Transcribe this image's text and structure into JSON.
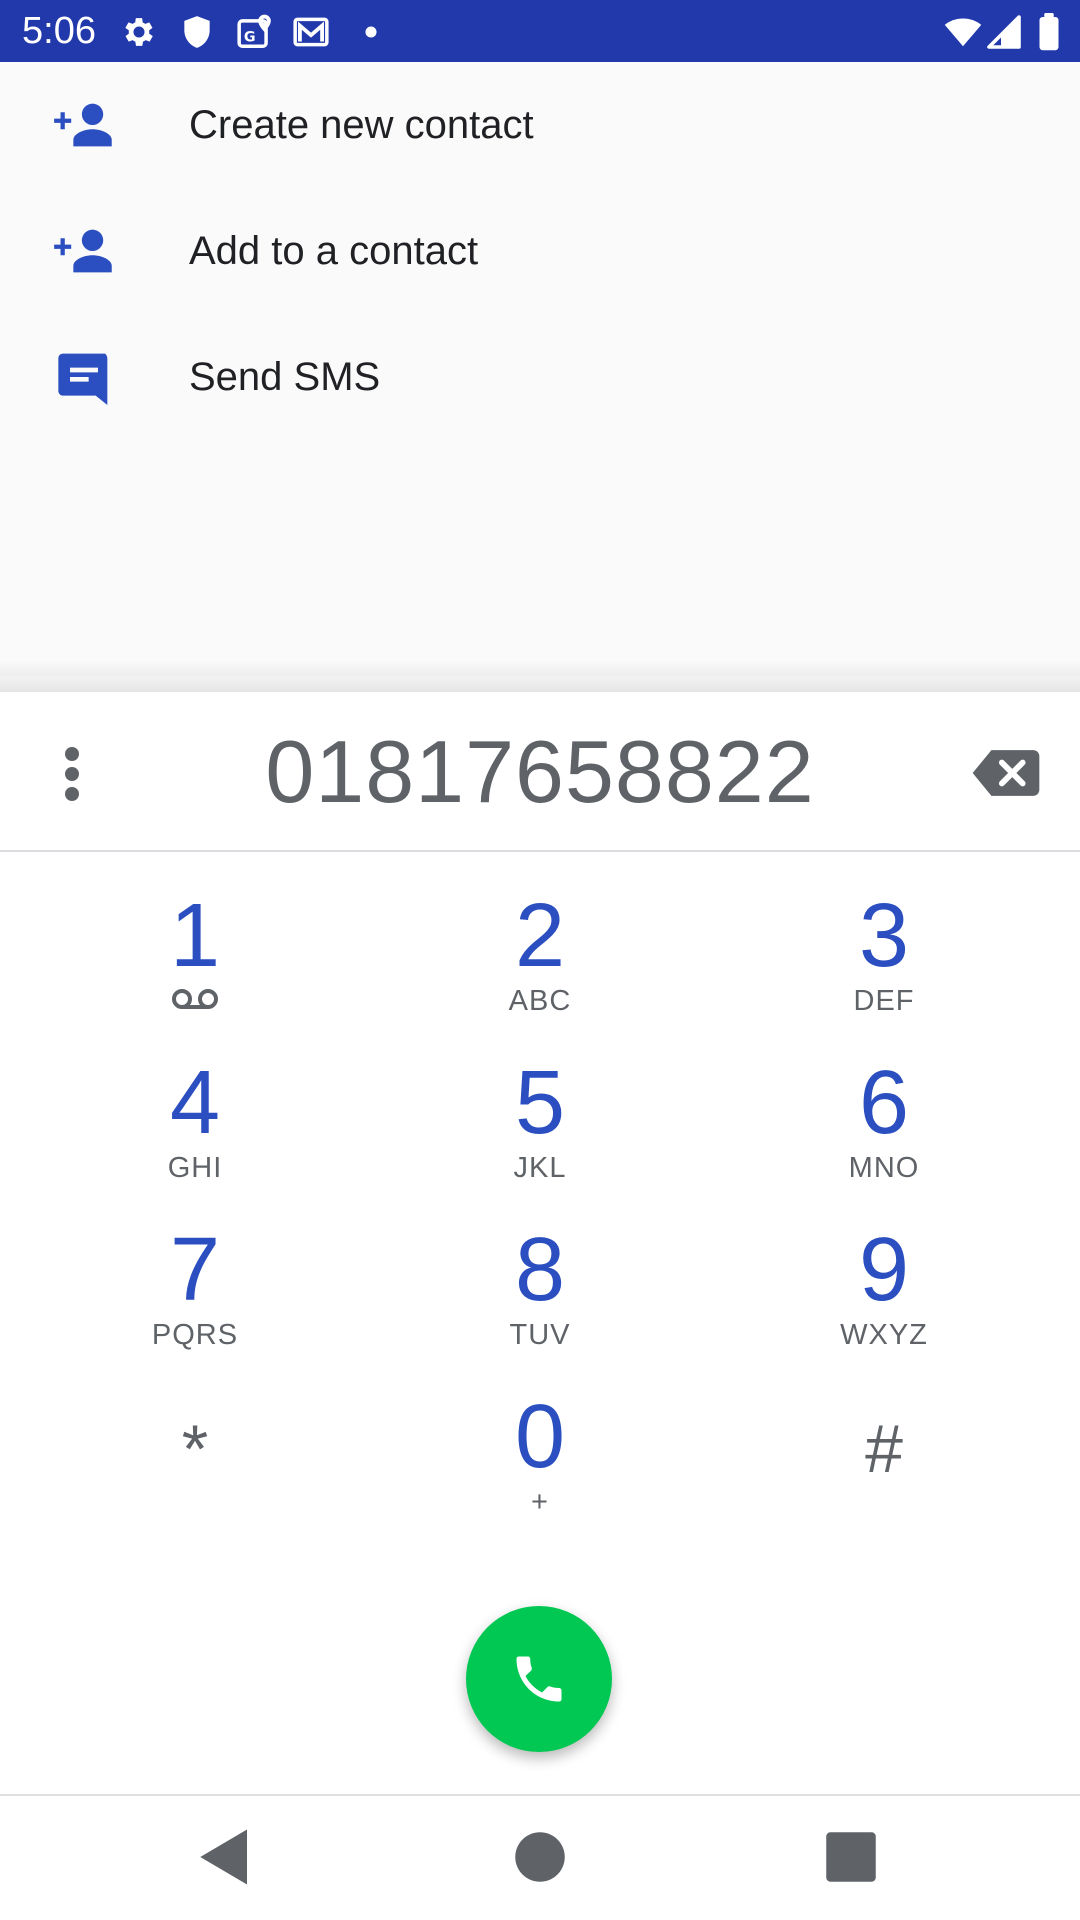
{
  "status_bar": {
    "time": "5:06",
    "icons": [
      "gear-icon",
      "shield-icon",
      "map-icon",
      "mail-icon",
      "dot-icon",
      "wifi-icon",
      "signal-icon",
      "battery-icon"
    ],
    "background": "#2139ab"
  },
  "suggestions": {
    "items": [
      {
        "label": "Create new contact",
        "icon": "person-add-icon"
      },
      {
        "label": "Add to a contact",
        "icon": "person-add-icon"
      },
      {
        "label": "Send SMS",
        "icon": "message-icon"
      }
    ]
  },
  "dialer": {
    "number": "01817658822",
    "keys": [
      {
        "digit": "1",
        "letters": "",
        "voicemail": true
      },
      {
        "digit": "2",
        "letters": "ABC"
      },
      {
        "digit": "3",
        "letters": "DEF"
      },
      {
        "digit": "4",
        "letters": "GHI"
      },
      {
        "digit": "5",
        "letters": "JKL"
      },
      {
        "digit": "6",
        "letters": "MNO"
      },
      {
        "digit": "7",
        "letters": "PQRS"
      },
      {
        "digit": "8",
        "letters": "TUV"
      },
      {
        "digit": "9",
        "letters": "WXYZ"
      },
      {
        "digit": "*",
        "letters": ""
      },
      {
        "digit": "0",
        "letters": "+"
      },
      {
        "digit": "#",
        "letters": ""
      }
    ]
  },
  "colors": {
    "accent": "#2b4fc0",
    "call_button": "#00c853",
    "secondary_text": "#5f6368"
  }
}
